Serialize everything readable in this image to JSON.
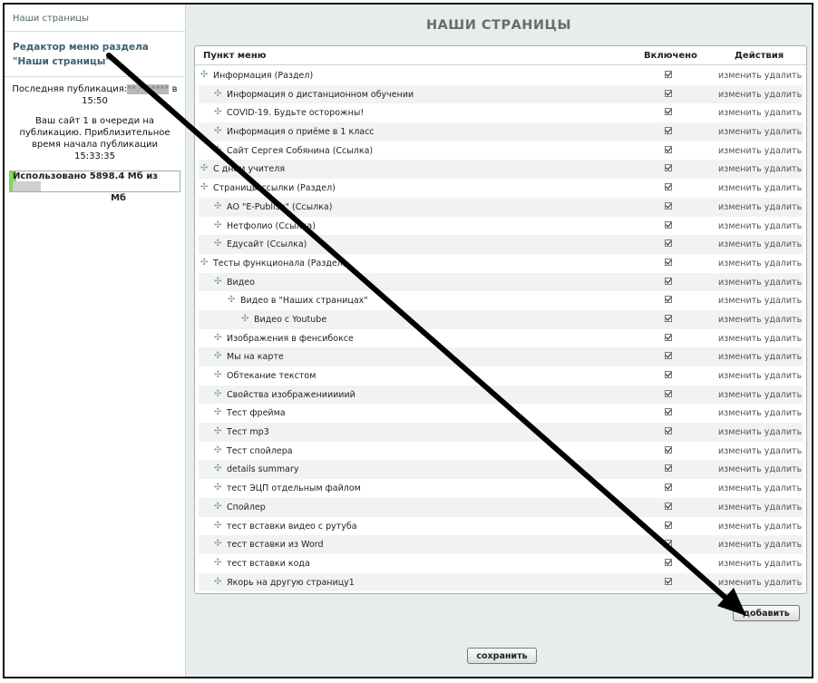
{
  "sidebar": {
    "title": "Наши страницы",
    "editor_link": "Редактор меню раздела \"Наши страницы\"",
    "last_publication_prefix": "Последняя публикация:",
    "last_publication_masked": "**.**.****",
    "last_publication_suffix": "в 15:50",
    "queue_text": "Ваш сайт 1 в очереди на публикацию. Приблизительное время начала публикации 15:33:35",
    "usage_text": "Использовано 5898.4 Мб из",
    "usage_unit": "Мб",
    "usage_fraction": 0.04
  },
  "main": {
    "title": "НАШИ СТРАНИЦЫ",
    "columns": {
      "item": "Пункт меню",
      "enabled": "Включено",
      "actions": "Действия"
    },
    "action_edit": "изменить",
    "action_delete": "удалить",
    "handle_glyph": "✣",
    "rows": [
      {
        "label": "Информация (Раздел)",
        "level": 0,
        "enabled": true
      },
      {
        "label": "Информация о дистанционном обучении",
        "level": 1,
        "enabled": true
      },
      {
        "label": "COVID-19. Будьте осторожны!",
        "level": 1,
        "enabled": true
      },
      {
        "label": "Информация о приёме в 1 класс",
        "level": 1,
        "enabled": true
      },
      {
        "label": "Сайт Сергея Собянина (Ссылка)",
        "level": 1,
        "enabled": true
      },
      {
        "label": "С днем учителя",
        "level": 0,
        "enabled": true
      },
      {
        "label": "Страницы ссылки (Раздел)",
        "level": 0,
        "enabled": true
      },
      {
        "label": "АО \"E-Publish\" (Ссылка)",
        "level": 1,
        "enabled": true
      },
      {
        "label": "Нетфолио (Ссылка)",
        "level": 1,
        "enabled": true
      },
      {
        "label": "Едусайт (Ссылка)",
        "level": 1,
        "enabled": true
      },
      {
        "label": "Тесты функционала (Раздел)",
        "level": 0,
        "enabled": true
      },
      {
        "label": "Видео",
        "level": 1,
        "enabled": true
      },
      {
        "label": "Видео в \"Наших страницах\"",
        "level": 2,
        "enabled": true
      },
      {
        "label": "Видео с Youtube",
        "level": 3,
        "enabled": true
      },
      {
        "label": "Изображения в фенсибоксе",
        "level": 1,
        "enabled": true
      },
      {
        "label": "Мы на карте",
        "level": 1,
        "enabled": true
      },
      {
        "label": "Обтекание текстом",
        "level": 1,
        "enabled": true
      },
      {
        "label": "Свойства изображенииииий",
        "level": 1,
        "enabled": true
      },
      {
        "label": "Тест фрейма",
        "level": 1,
        "enabled": true
      },
      {
        "label": "Тест mp3",
        "level": 1,
        "enabled": true
      },
      {
        "label": "Тест спойлера",
        "level": 1,
        "enabled": true
      },
      {
        "label": "details summary",
        "level": 1,
        "enabled": true
      },
      {
        "label": "тест ЭЦП отдельным файлом",
        "level": 1,
        "enabled": true
      },
      {
        "label": "Спойлер",
        "level": 1,
        "enabled": true
      },
      {
        "label": "тест вставки видео с рутуба",
        "level": 1,
        "enabled": true
      },
      {
        "label": "тест вставки из Word",
        "level": 1,
        "enabled": true
      },
      {
        "label": "тест вставки кода",
        "level": 1,
        "enabled": true
      },
      {
        "label": "Якорь на другую страницу1",
        "level": 1,
        "enabled": true
      }
    ],
    "add_button": "добавить",
    "save_button": "сохранить"
  }
}
